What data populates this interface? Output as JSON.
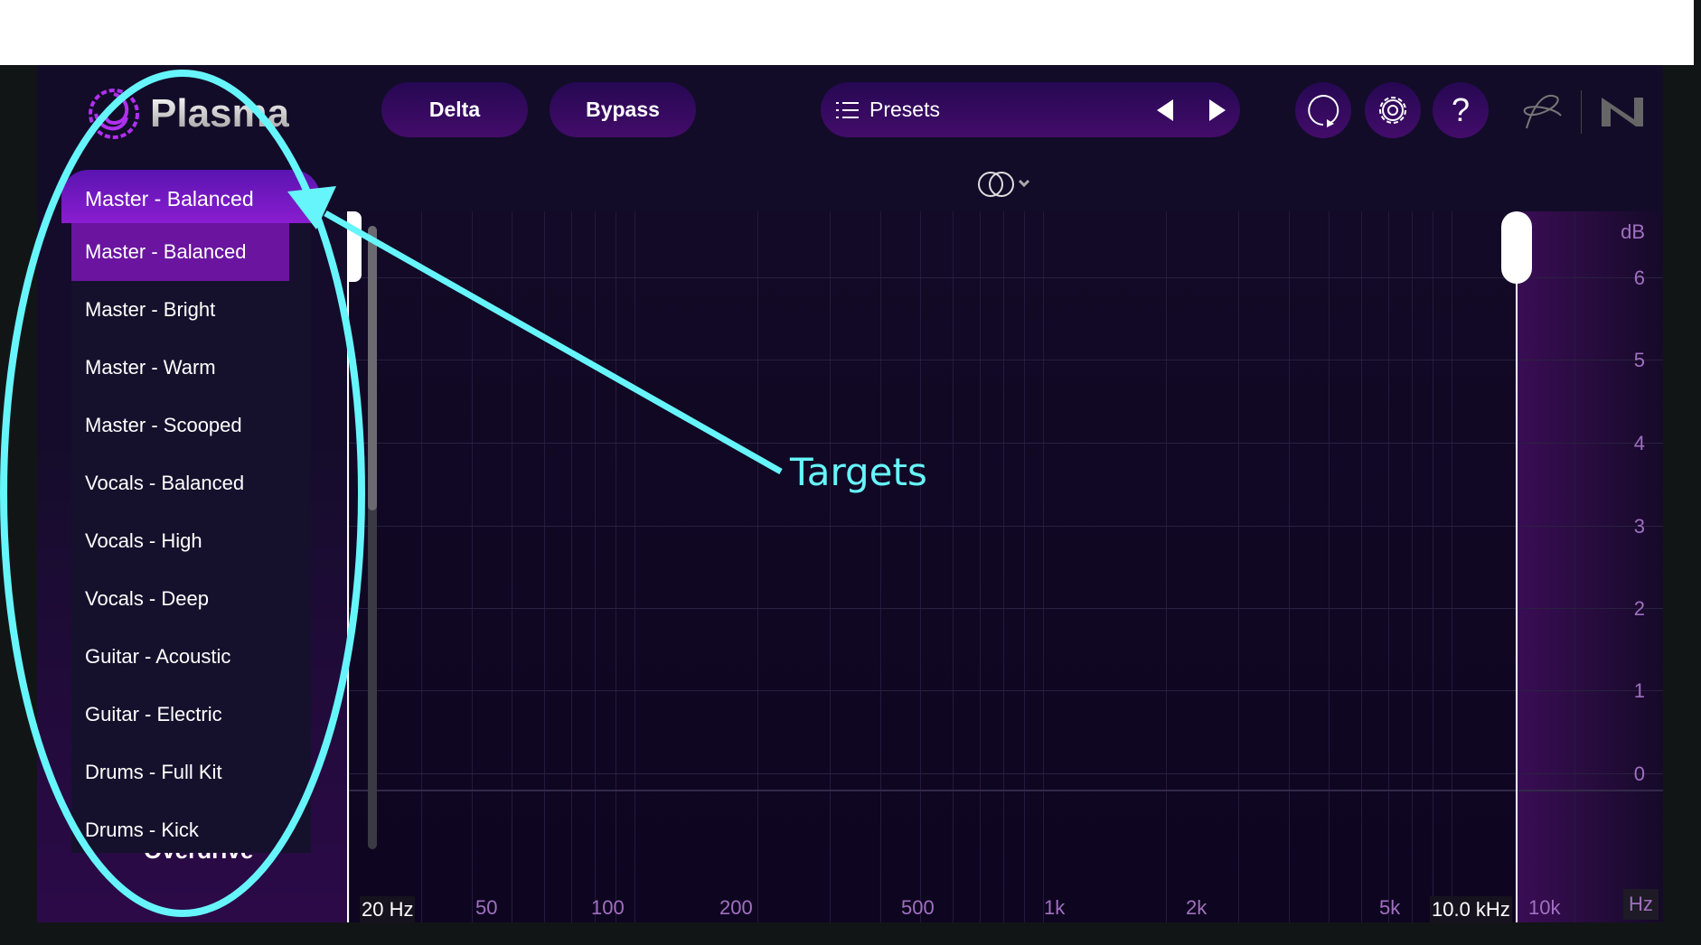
{
  "app": {
    "name": "Plasma"
  },
  "header": {
    "delta_label": "Delta",
    "bypass_label": "Bypass",
    "presets_label": "Presets"
  },
  "icons": {
    "logo": "spiral-logo-icon",
    "menu": "list-icon",
    "prev": "triangle-left-icon",
    "next": "triangle-right-icon",
    "undo": "refresh-icon",
    "settings": "gear-icon",
    "help": "question-icon",
    "brand1": "ni-scribble-icon",
    "brand2": "ni-logo-icon",
    "stereo": "stereo-link-icon"
  },
  "dropdown": {
    "selected": "Master - Balanced",
    "items": [
      "Master - Balanced",
      "Master - Bright",
      "Master - Warm",
      "Master - Scooped",
      "Vocals - Balanced",
      "Vocals - High",
      "Vocals - Deep",
      "Guitar - Acoustic",
      "Guitar - Electric",
      "Drums - Full Kit",
      "Drums - Kick"
    ]
  },
  "hidden_label": "Overdrive",
  "graph": {
    "db_unit": "dB",
    "db_ticks": [
      "6",
      "5",
      "4",
      "3",
      "2",
      "1",
      "0"
    ],
    "freq_ticks": [
      "20 Hz",
      "50",
      "100",
      "200",
      "500",
      "1k",
      "2k",
      "5k",
      "10k"
    ],
    "freq_unit": "Hz",
    "cutoff_readout": "10.0 kHz"
  },
  "annotation": {
    "label": "Targets",
    "color": "#66f5fa"
  },
  "colors": {
    "accent": "#8a1dd0",
    "background": "#120c28",
    "annotation": "#66f5fa"
  }
}
